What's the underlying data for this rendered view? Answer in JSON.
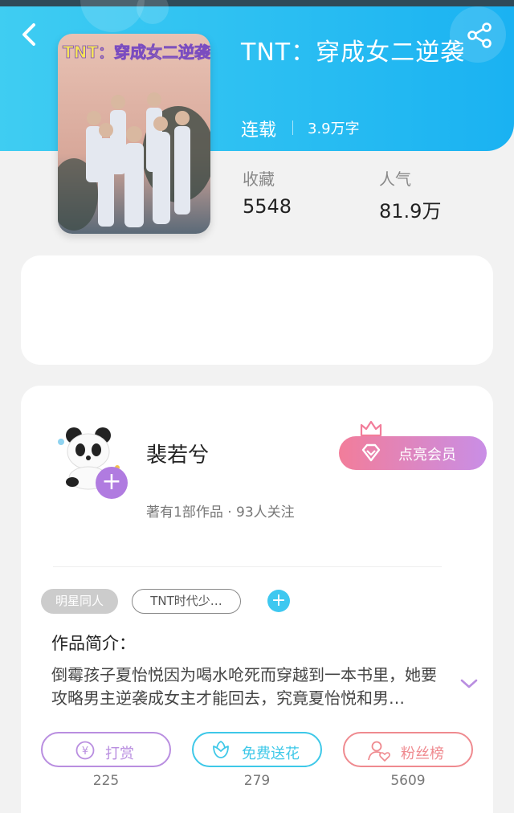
{
  "header": {
    "back_icon": "chevron-left-icon",
    "share_icon": "share-icon"
  },
  "book": {
    "title": "TNT：穿成女二逆袭",
    "status": "连载",
    "words": "3.9万字",
    "cover_text": "TNT：穿成女二逆袭"
  },
  "stats": [
    {
      "label": "收藏",
      "value": "5548"
    },
    {
      "label": "人气",
      "value": "81.9万"
    }
  ],
  "author": {
    "name": "裴若兮",
    "meta": "著有1部作品 · 93人关注",
    "follow_plus": "+",
    "vip_button": "点亮会员"
  },
  "tags": {
    "category": "明星同人",
    "topic": "TNT时代少…",
    "add": "+"
  },
  "intro": {
    "title": "作品简介：",
    "text": "倒霉孩子夏怡悦因为喝水呛死而穿越到一本书里，她要攻略男主逆袭成女主才能回去，究竟夏怡悦和男…"
  },
  "actions": [
    {
      "label": "打赏",
      "count": "225",
      "icon": "yuan-coin-icon",
      "color": "#b98ee0"
    },
    {
      "label": "免费送花",
      "count": "279",
      "icon": "flower-icon",
      "color": "#3ec8e8"
    },
    {
      "label": "粉丝榜",
      "count": "5609",
      "icon": "user-heart-icon",
      "color": "#ef8a8f"
    }
  ]
}
